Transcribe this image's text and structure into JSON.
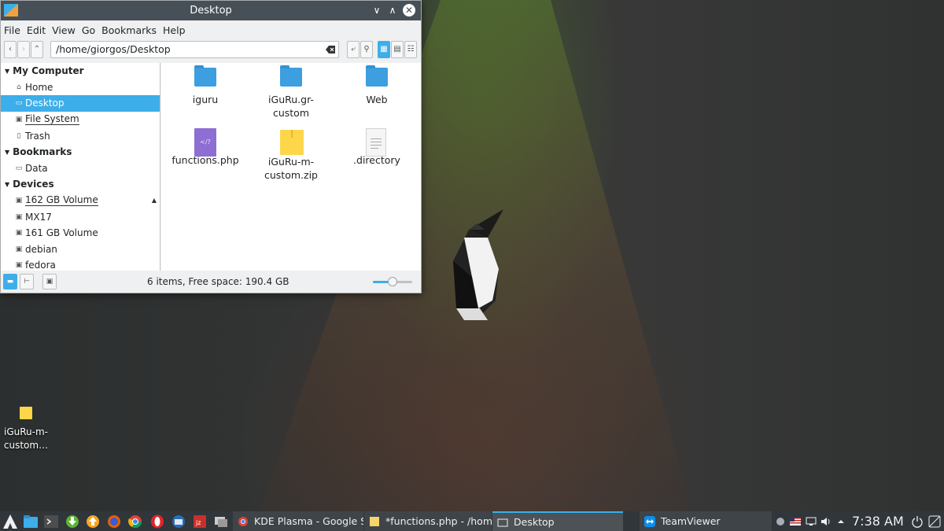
{
  "window": {
    "title": "Desktop",
    "menu": [
      "File",
      "Edit",
      "View",
      "Go",
      "Bookmarks",
      "Help"
    ],
    "location_path": "/home/giorgos/Desktop"
  },
  "places": {
    "my_computer": {
      "header": "My Computer",
      "items": [
        "Home",
        "Desktop",
        "File System",
        "Trash"
      ]
    },
    "bookmarks": {
      "header": "Bookmarks",
      "items": [
        "Data"
      ]
    },
    "devices": {
      "header": "Devices",
      "items": [
        "162 GB Volume",
        "MX17",
        "161 GB Volume",
        "debian",
        "fedora"
      ]
    },
    "selected": "Desktop"
  },
  "files": [
    {
      "name": "iguru",
      "line2": "",
      "type": "folder"
    },
    {
      "name": "iGuRu.gr-",
      "line2": "custom",
      "type": "folder"
    },
    {
      "name": "Web",
      "line2": "",
      "type": "folder"
    },
    {
      "name": "functions.php",
      "line2": "",
      "type": "php"
    },
    {
      "name": "iGuRu-m-",
      "line2": "custom.zip",
      "type": "zip"
    },
    {
      "name": ".directory",
      "line2": "",
      "type": "text"
    }
  ],
  "status": {
    "text": "6 items, Free space: 190.4 GB",
    "zoom_fraction": 0.5
  },
  "desktop_icon": {
    "line1": "iGuRu-m-",
    "line2": "custom…"
  },
  "taskbar": {
    "tasks": [
      {
        "label": "KDE Plasma - Google Se..."
      },
      {
        "label": "*functions.php - /home..."
      },
      {
        "label": "Desktop"
      },
      {
        "label": "TeamViewer"
      }
    ],
    "clock": "7:38 AM"
  },
  "colors": {
    "accent": "#3daee9",
    "titlebar": "#475057",
    "taskbar": "#31363b",
    "folder": "#3d9ee0"
  }
}
